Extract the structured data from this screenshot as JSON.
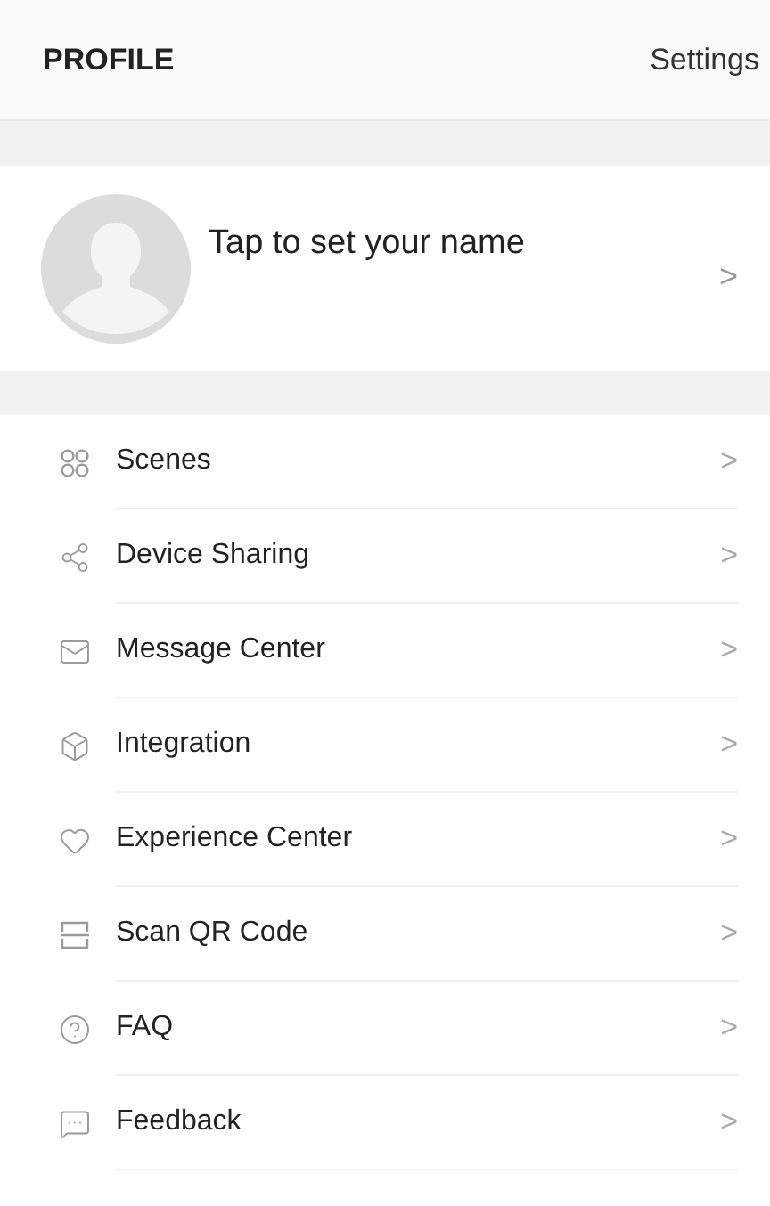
{
  "header": {
    "title": "PROFILE",
    "action": "Settings"
  },
  "profile": {
    "name_prompt": "Tap to set your name",
    "chevron": ">"
  },
  "menu": [
    {
      "label": "Scenes",
      "chevron": ">"
    },
    {
      "label": "Device Sharing",
      "chevron": ">"
    },
    {
      "label": "Message Center",
      "chevron": ">"
    },
    {
      "label": "Integration",
      "chevron": ">"
    },
    {
      "label": "Experience Center",
      "chevron": ">"
    },
    {
      "label": "Scan QR Code",
      "chevron": ">"
    },
    {
      "label": "FAQ",
      "chevron": ">"
    },
    {
      "label": "Feedback",
      "chevron": ">"
    }
  ]
}
